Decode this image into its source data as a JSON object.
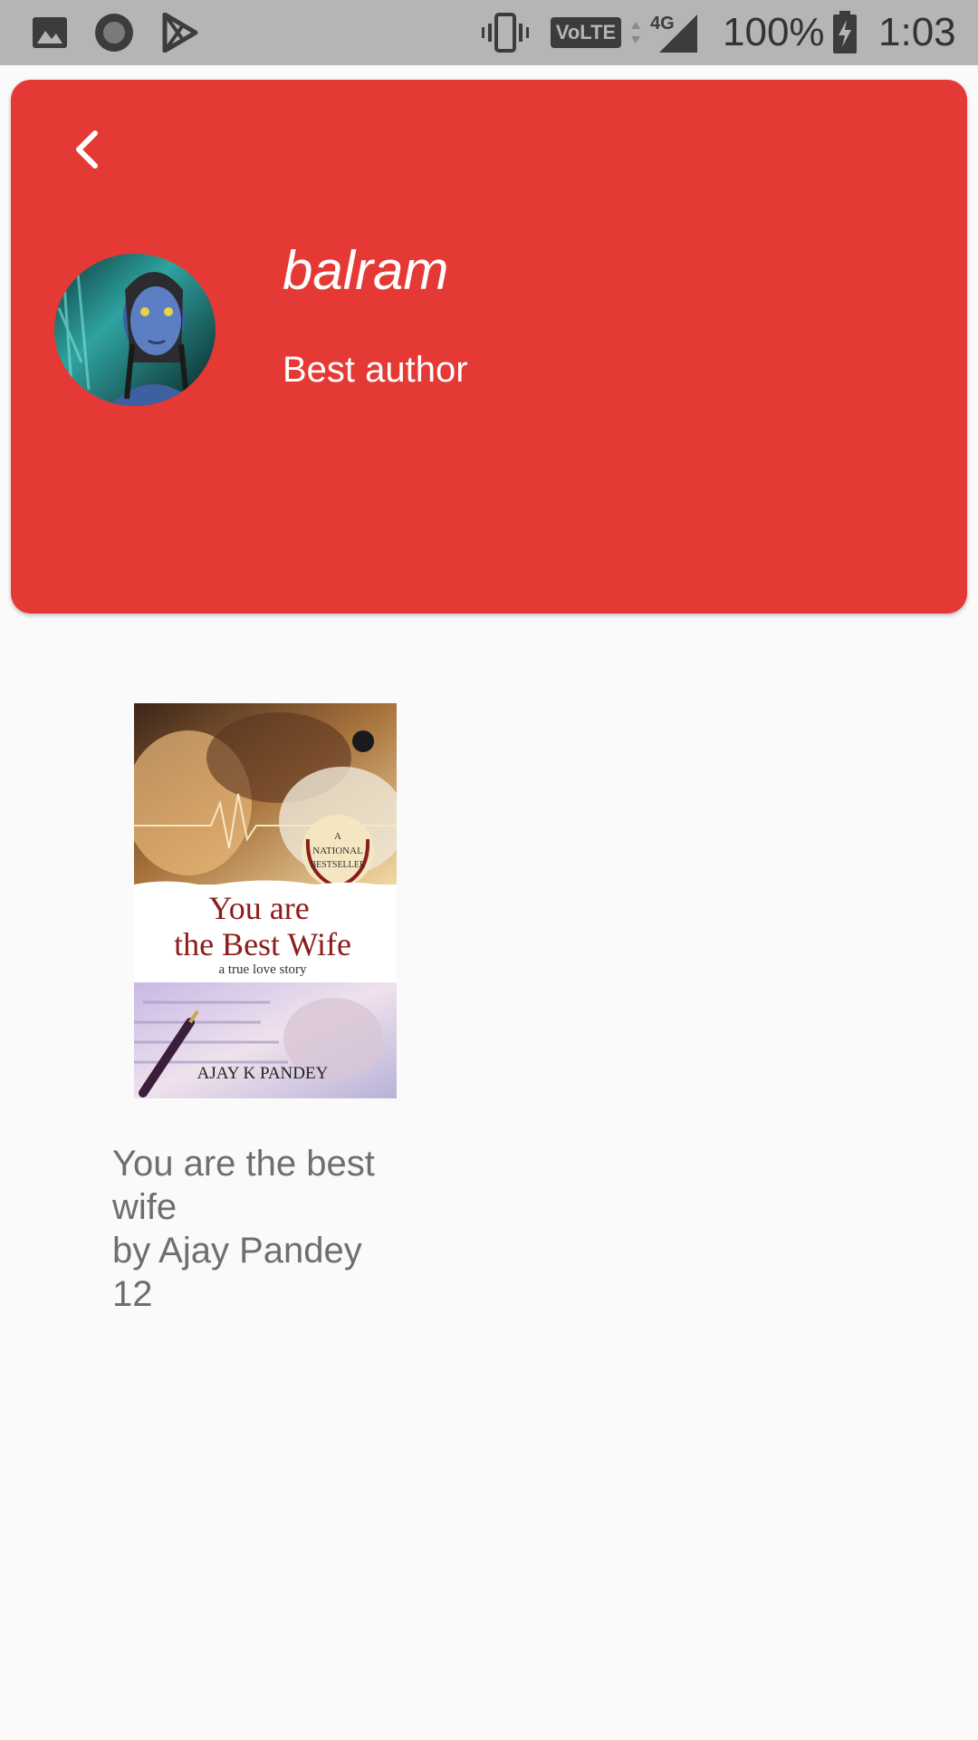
{
  "status_bar": {
    "network": "4G",
    "volte": "VoLTE",
    "battery": "100%",
    "time": "1:03",
    "icons": [
      "gallery-icon",
      "record-icon",
      "play-store-icon",
      "vibrate-icon",
      "volte-icon",
      "signal-icon",
      "battery-charging-icon"
    ]
  },
  "header": {
    "background_color": "#e53935",
    "back_icon": "chevron-left-icon",
    "author_name": "balram",
    "author_tagline": "Best author"
  },
  "books": [
    {
      "cover": {
        "badge_line1": "A",
        "badge_line2": "NATIONAL",
        "badge_line3": "BESTSELLER",
        "title_line1": "You are",
        "title_line2": "the Best Wife",
        "subtitle": "a true love story",
        "author": "AJAY K PANDEY"
      },
      "title_line1": "You are the best",
      "title_line2": "wife",
      "byline": "by Ajay Pandey",
      "count": "12"
    }
  ]
}
